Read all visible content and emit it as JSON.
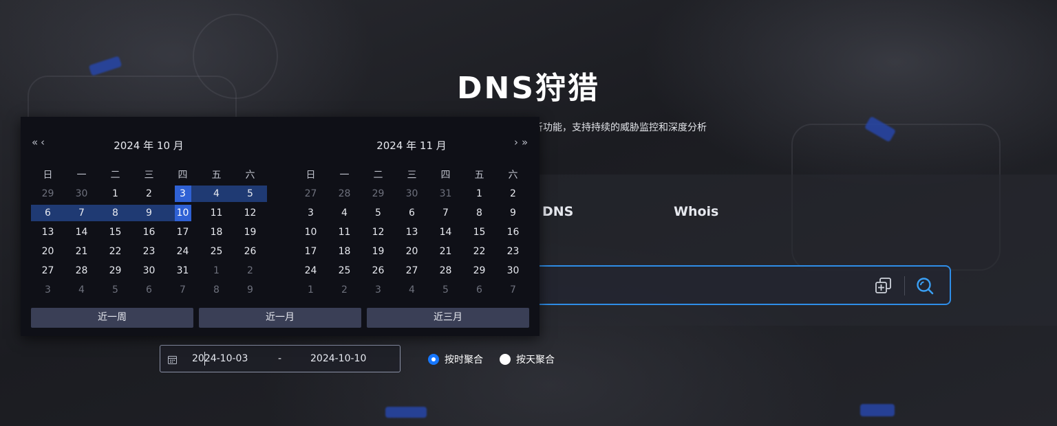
{
  "header": {
    "title": "DNS狩猎",
    "subtitle": "析功能，支持持续的威胁监控和深度分析"
  },
  "tabs": [
    "DNS",
    "Whois"
  ],
  "search": {
    "add_icon": "add-copy-icon",
    "search_icon": "search-icon"
  },
  "date_range": {
    "start": "2024-10-03",
    "separator": "-",
    "end": "2024-10-10",
    "icon": "calendar-icon"
  },
  "aggregation": {
    "options": [
      "按时聚合",
      "按天聚合"
    ],
    "selected": "按时聚合"
  },
  "calendar": {
    "nav": {
      "prev_year": "«",
      "prev_month": "‹",
      "next_month": "›",
      "next_year": "»"
    },
    "weekdays": [
      "日",
      "一",
      "二",
      "三",
      "四",
      "五",
      "六"
    ],
    "months": [
      {
        "title": "2024 年 10 月",
        "rows": [
          [
            "29",
            "30",
            "1",
            "2",
            "3",
            "4",
            "5"
          ],
          [
            "6",
            "7",
            "8",
            "9",
            "10",
            "11",
            "12"
          ],
          [
            "13",
            "14",
            "15",
            "16",
            "17",
            "18",
            "19"
          ],
          [
            "20",
            "21",
            "22",
            "23",
            "24",
            "25",
            "26"
          ],
          [
            "27",
            "28",
            "29",
            "30",
            "31",
            "1",
            "2"
          ],
          [
            "3",
            "4",
            "5",
            "6",
            "7",
            "8",
            "9"
          ]
        ]
      },
      {
        "title": "2024 年 11 月",
        "rows": [
          [
            "27",
            "28",
            "29",
            "30",
            "31",
            "1",
            "2"
          ],
          [
            "3",
            "4",
            "5",
            "6",
            "7",
            "8",
            "9"
          ],
          [
            "10",
            "11",
            "12",
            "13",
            "14",
            "15",
            "16"
          ],
          [
            "17",
            "18",
            "19",
            "20",
            "21",
            "22",
            "23"
          ],
          [
            "24",
            "25",
            "26",
            "27",
            "28",
            "29",
            "30"
          ],
          [
            "1",
            "2",
            "3",
            "4",
            "5",
            "6",
            "7"
          ]
        ]
      }
    ],
    "range": {
      "start": "2024-10-03",
      "end": "2024-10-10"
    },
    "quick_ranges": [
      "近一周",
      "近一月",
      "近三月"
    ]
  },
  "colors": {
    "accent": "#1677ff",
    "range_fill": "#1f3a73",
    "range_edge": "#2f61d4",
    "search_border": "#2f8ee8"
  }
}
